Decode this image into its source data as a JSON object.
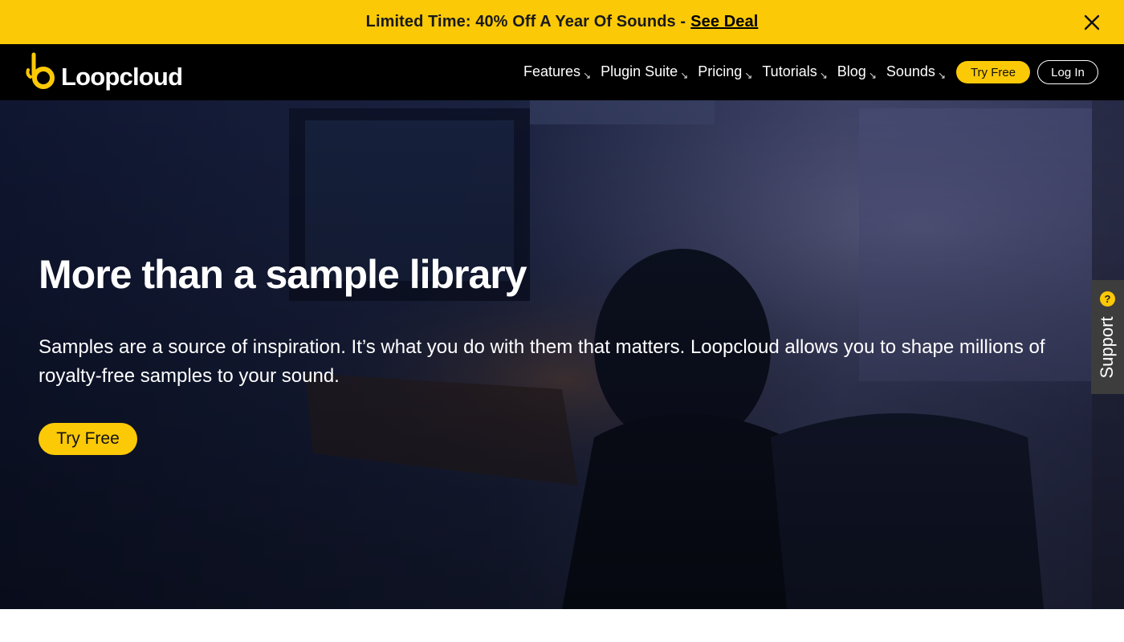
{
  "promo": {
    "text": "Limited Time: 40% Off A Year Of Sounds -",
    "link": "See Deal",
    "close_icon": "close-icon"
  },
  "nav": {
    "logo_text": "Loopcloud",
    "logo_icon": "loopcloud-logo-icon",
    "items": [
      {
        "label": "Features",
        "icon": "arrow-down-right-icon"
      },
      {
        "label": "Plugin Suite",
        "icon": "arrow-down-right-icon"
      },
      {
        "label": "Pricing",
        "icon": "arrow-down-right-icon"
      },
      {
        "label": "Tutorials",
        "icon": "arrow-down-right-icon"
      },
      {
        "label": "Blog",
        "icon": "arrow-down-right-icon"
      },
      {
        "label": "Sounds",
        "icon": "arrow-down-right-icon"
      }
    ],
    "try_free": "Try Free",
    "log_in": "Log In"
  },
  "hero": {
    "title": "More than a sample library",
    "description": "Samples are a source of inspiration. It’s what you do with them that matters. Loopcloud allows you to shape millions of royalty-free samples to your sound.",
    "cta": "Try Free"
  },
  "support": {
    "label": "Support",
    "icon_glyph": "?"
  },
  "colors": {
    "accent": "#fcc907",
    "nav_bg": "#000000",
    "hero_bg": "#121a33"
  }
}
